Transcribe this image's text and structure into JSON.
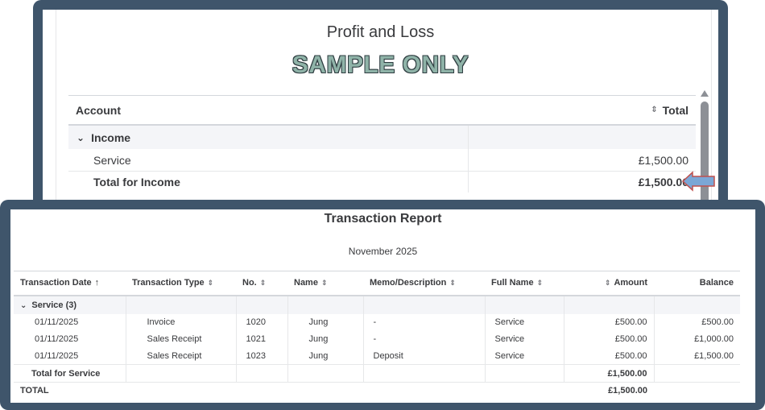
{
  "profit_loss": {
    "title": "Profit and Loss",
    "watermark": "SAMPLE ONLY",
    "columns": {
      "account": "Account",
      "total": "Total"
    },
    "group": {
      "label": "Income"
    },
    "rows": [
      {
        "label": "Service",
        "amount": "£1,500.00"
      }
    ],
    "total": {
      "label": "Total for Income",
      "amount": "£1,500.00"
    }
  },
  "transaction_report": {
    "title": "Transaction Report",
    "period": "November 2025",
    "columns": {
      "date": "Transaction Date",
      "type": "Transaction Type",
      "no": "No.",
      "name": "Name",
      "memo": "Memo/Description",
      "full_name": "Full Name",
      "amount": "Amount",
      "balance": "Balance"
    },
    "group": {
      "label": "Service (3)"
    },
    "rows": [
      {
        "date": "01/11/2025",
        "type": "Invoice",
        "no": "1020",
        "name": "Jung",
        "memo": "-",
        "full_name": "Service",
        "amount": "£500.00",
        "balance": "£500.00"
      },
      {
        "date": "01/11/2025",
        "type": "Sales Receipt",
        "no": "1021",
        "name": "Jung",
        "memo": "-",
        "full_name": "Service",
        "amount": "£500.00",
        "balance": "£1,000.00"
      },
      {
        "date": "01/11/2025",
        "type": "Sales Receipt",
        "no": "1023",
        "name": "Jung",
        "memo": "Deposit",
        "full_name": "Service",
        "amount": "£500.00",
        "balance": "£1,500.00"
      }
    ],
    "group_total": {
      "label": "Total for Service",
      "amount": "£1,500.00"
    },
    "grand_total": {
      "label": "TOTAL",
      "amount": "£1,500.00"
    }
  },
  "colors": {
    "frame": "#3f556b",
    "watermark_fill": "#8fb3a8",
    "arrow_fill": "#7ba7d6",
    "arrow_outline": "#c0504d"
  },
  "icons": {
    "sort": "sort-icon",
    "sort_asc": "arrow-up-icon",
    "expand": "chevron-down-icon",
    "callout": "arrow-left-callout-icon"
  }
}
